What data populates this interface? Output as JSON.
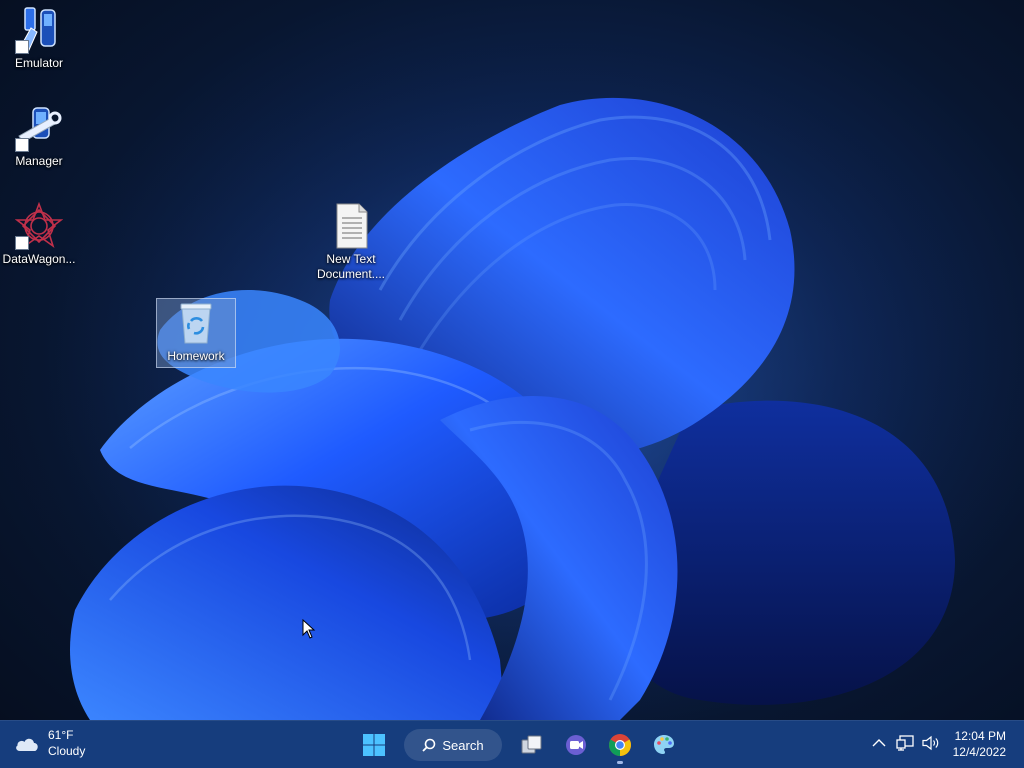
{
  "desktop": {
    "icons": [
      {
        "label": "Emulator",
        "icon": "emulator-icon"
      },
      {
        "label": "Manager",
        "icon": "manager-icon"
      },
      {
        "label": "DataWagon...",
        "icon": "datawagon-icon"
      },
      {
        "label": "New Text Document....",
        "icon": "text-document-icon"
      },
      {
        "label": "Homework",
        "icon": "recycle-bin-icon",
        "selected": true
      }
    ]
  },
  "taskbar": {
    "weather": {
      "temperature": "61°F",
      "condition": "Cloudy",
      "icon": "cloud-icon"
    },
    "start": {
      "icon": "windows-start-icon"
    },
    "search": {
      "label": "Search",
      "icon": "search-icon"
    },
    "apps": [
      {
        "icon": "task-view-icon",
        "running": false
      },
      {
        "icon": "teams-meet-icon",
        "running": false
      },
      {
        "icon": "chrome-icon",
        "running": true
      },
      {
        "icon": "paint-palette-icon",
        "running": false
      }
    ],
    "tray": [
      {
        "icon": "chevron-up-icon"
      },
      {
        "icon": "network-icon"
      },
      {
        "icon": "volume-icon"
      }
    ],
    "clock": {
      "time": "12:04 PM",
      "date": "12/4/2022"
    }
  },
  "colors": {
    "taskbar": "#163d7d",
    "wallpaper_primary": "#1f5bff",
    "wallpaper_background": "#0a1a36"
  }
}
